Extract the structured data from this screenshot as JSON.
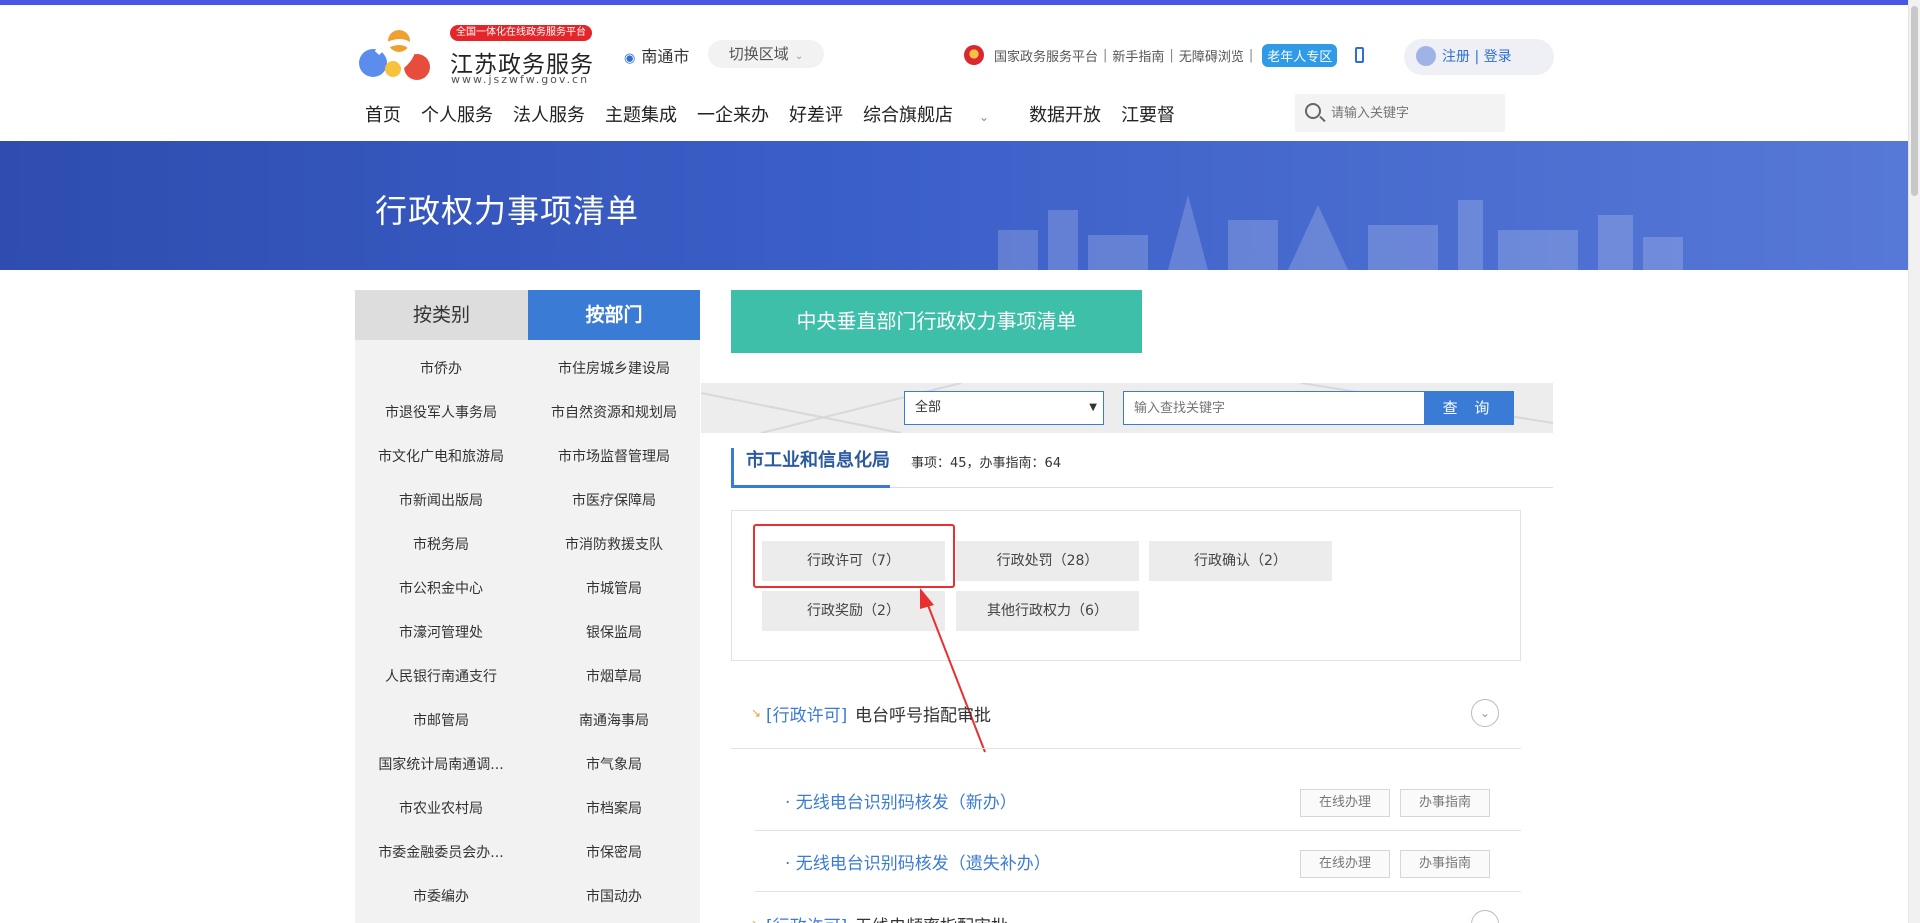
{
  "header": {
    "logo_badge": "全国一体化在线政务服务平台",
    "logo_title": "江苏政务服务",
    "logo_url": "www.jszwfw.gov.cn",
    "city": "南通市",
    "switch_region": "切换区域",
    "links": {
      "national": "国家政务服务平台",
      "guide": "新手指南",
      "accessible": "无障碍浏览",
      "elder": "老年人专区"
    },
    "register": "注册",
    "login": "登录",
    "nav": [
      "首页",
      "个人服务",
      "法人服务",
      "主题集成",
      "一企来办",
      "好差评",
      "综合旗舰店",
      "数据开放",
      "江要督"
    ],
    "search_placeholder": "请输入关键字"
  },
  "banner": {
    "title": "行政权力事项清单"
  },
  "left": {
    "tab_category": "按类别",
    "tab_department": "按部门",
    "departments": [
      [
        "市侨办",
        "市住房城乡建设局"
      ],
      [
        "市退役军人事务局",
        "市自然资源和规划局"
      ],
      [
        "市文化广电和旅游局",
        "市市场监督管理局"
      ],
      [
        "市新闻出版局",
        "市医疗保障局"
      ],
      [
        "市税务局",
        "市消防救援支队"
      ],
      [
        "市公积金中心",
        "市城管局"
      ],
      [
        "市濠河管理处",
        "银保监局"
      ],
      [
        "人民银行南通支行",
        "市烟草局"
      ],
      [
        "市邮管局",
        "南通海事局"
      ],
      [
        "国家统计局南通调...",
        "市气象局"
      ],
      [
        "市农业农村局",
        "市档案局"
      ],
      [
        "市委金融委员会办...",
        "市保密局"
      ],
      [
        "市委编办",
        "市国动办"
      ]
    ]
  },
  "main": {
    "central_button": "中央垂直部门行政权力事项清单",
    "select_value": "全部",
    "keyword_placeholder": "输入查找关键字",
    "query_button": "查 询",
    "dept_name": "市工业和信息化局",
    "dept_stats": "事项：45，办事指南：64",
    "categories": [
      "行政许可（7）",
      "行政处罚（28）",
      "行政确认（2）",
      "行政奖励（2）",
      "其他行政权力（6）"
    ],
    "items": [
      {
        "tag": "[行政许可]",
        "title": "电台呼号指配审批",
        "subs": [
          {
            "name": "· 无线电台识别码核发（新办）",
            "online": "在线办理",
            "guide": "办事指南"
          },
          {
            "name": "· 无线电台识别码核发（遗失补办）",
            "online": "在线办理",
            "guide": "办事指南"
          }
        ]
      },
      {
        "tag": "[行政许可]",
        "title": "无线电频率指配审批"
      }
    ]
  },
  "colors": {
    "accent_blue": "#3a7bd5",
    "teal": "#3dbfaa",
    "highlight_red": "#e8302f",
    "banner_blue": "#2f4db0"
  }
}
